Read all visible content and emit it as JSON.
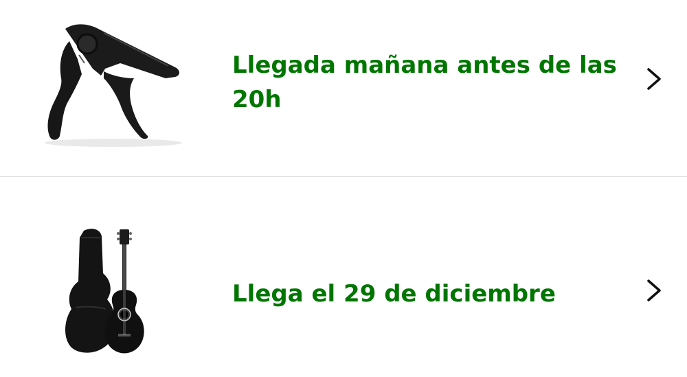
{
  "orders": [
    {
      "delivery_text": "Llegada mañana antes de las 20h",
      "product_icon": "guitar-capo",
      "chevron_icon": "chevron-right"
    },
    {
      "delivery_text": "Llega el 29 de diciembre",
      "product_icon": "acoustic-guitar-with-gig-bag",
      "chevron_icon": "chevron-right"
    }
  ],
  "colors": {
    "delivery_green": "#007600",
    "divider": "#e3e6e6",
    "chevron": "#111111",
    "background": "#ffffff"
  }
}
